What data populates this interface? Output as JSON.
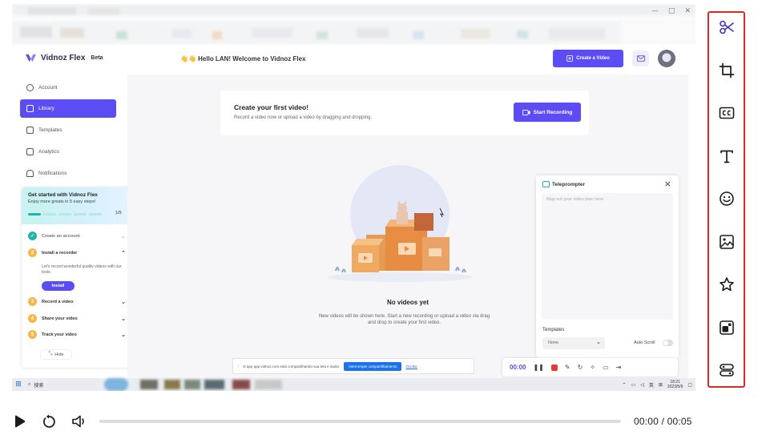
{
  "window": {
    "controls": [
      "—",
      "□",
      "✕"
    ]
  },
  "app": {
    "brand_name": "Vidnoz Flex",
    "brand_tag": "Beta",
    "greeting": "👋👋 Hello LAN! Welcome to Vidnoz Flex",
    "create_button": "Create a Video",
    "accent_color": "#5b4df3"
  },
  "sidebar": {
    "items": [
      {
        "label": "Account",
        "active": false
      },
      {
        "label": "Library",
        "active": true
      },
      {
        "label": "Templates",
        "active": false
      },
      {
        "label": "Analytics",
        "active": false
      },
      {
        "label": "Notifications",
        "active": false
      }
    ]
  },
  "get_started": {
    "title": "Get started with Vidnoz Flex",
    "subtitle": "Enjoy more greats in 5 easy steps!",
    "progress": "1/5",
    "steps": [
      {
        "num": "✓",
        "label": "Create an account"
      },
      {
        "num": "2",
        "label": "Install a recorder"
      },
      {
        "num": "3",
        "label": "Record a video"
      },
      {
        "num": "4",
        "label": "Share your video"
      },
      {
        "num": "5",
        "label": "Track your video"
      }
    ],
    "install_desc": "Let's record wonderful quality videos with our tools.",
    "install_button": "Install",
    "hide_label": "Hide"
  },
  "main": {
    "cta_title": "Create your first video!",
    "cta_subtitle": "Record a video now or upload a video by dragging and dropping.",
    "start_recording": "Start Recording",
    "empty_title": "No videos yet",
    "empty_subtitle": "New videos will be shown here. Start a new recording or upload a video via drag and drop to create your first video."
  },
  "teleprompter": {
    "title": "Teleprompter",
    "placeholder": "Map out your video plan here",
    "templates_label": "Templates",
    "template_value": "None",
    "auto_scroll_label": "Auto Scroll"
  },
  "recorder": {
    "time": "00:00"
  },
  "share_notice": {
    "text": "O app app.vidnoz.com está compartilhando sua tela e áudio.",
    "stop_button": "Interromper compartilhamento",
    "hide_link": "Ocultar"
  },
  "taskbar": {
    "search": "搜索",
    "tray": "英",
    "clock_time": "18:21",
    "clock_date": "2023/5/9"
  },
  "player": {
    "time_readout": "00:00 / 00:05",
    "progress": 0
  },
  "edit_tools": [
    {
      "icon": "scissors-icon"
    },
    {
      "icon": "crop-icon"
    },
    {
      "icon": "captions-icon"
    },
    {
      "icon": "text-icon"
    },
    {
      "icon": "emoji-icon"
    },
    {
      "icon": "image-icon"
    },
    {
      "icon": "star-icon"
    },
    {
      "icon": "sticker-icon"
    },
    {
      "icon": "layout-icon"
    }
  ],
  "colors": {
    "toolbar_border": "#e02727",
    "tool_icon": "#3b35b8"
  }
}
